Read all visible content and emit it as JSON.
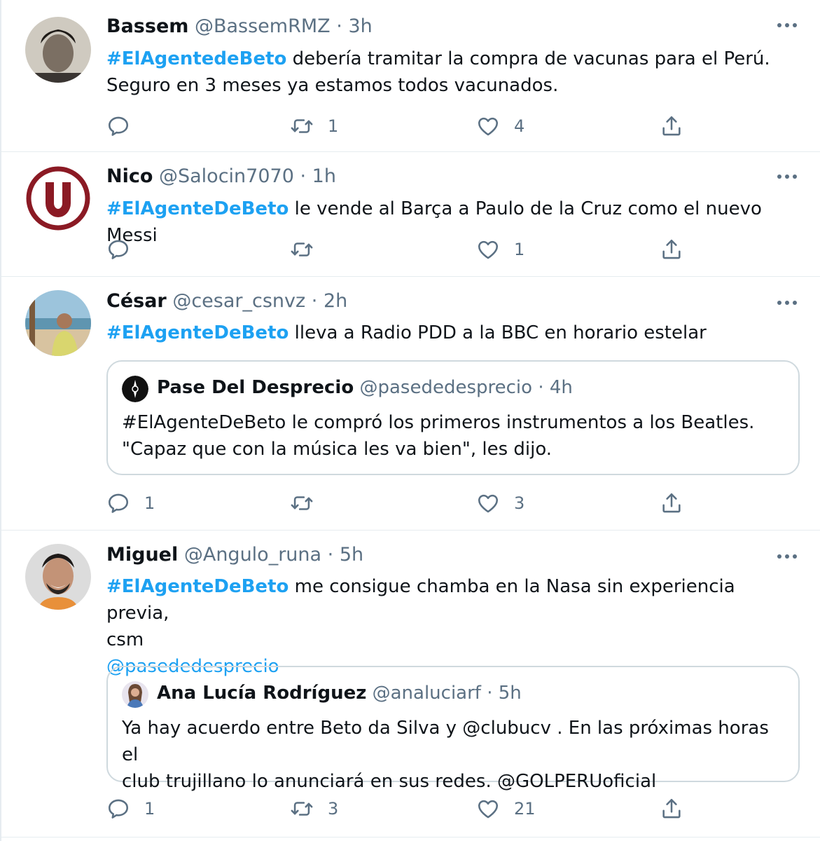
{
  "tweets": [
    {
      "name": "Bassem",
      "handle": "@BassemRMZ",
      "time": "3h",
      "hashtag": "#ElAgentedeBeto",
      "text": " debería tramitar la compra de vacunas para el Perú. Seguro en 3 meses ya estamos todos vacunados.",
      "replies": "",
      "retweets": "1",
      "likes": "4"
    },
    {
      "name": "Nico",
      "handle": "@Salocin7070",
      "time": "1h",
      "hashtag": "#ElAgenteDeBeto",
      "text": " le vende al Barça a Paulo de la Cruz como el nuevo Messi",
      "replies": "",
      "retweets": "",
      "likes": "1"
    },
    {
      "name": "César",
      "handle": "@cesar_csnvz",
      "time": "2h",
      "hashtag": "#ElAgenteDeBeto",
      "text": " lleva a Radio PDD a la BBC en horario estelar",
      "quote": {
        "name": "Pase Del Desprecio",
        "handle": "@pasededesprecio",
        "time": "4h",
        "line1": "#ElAgenteDeBeto le compró los primeros instrumentos a los Beatles.",
        "line2": "\"Capaz que con la música les va bien\", les dijo."
      },
      "replies": "1",
      "retweets": "",
      "likes": "3"
    },
    {
      "name": "Miguel",
      "handle": "@Angulo_runa",
      "time": "5h",
      "hashtag": "#ElAgenteDeBeto",
      "text": " me consigue chamba en la Nasa sin experiencia previa,",
      "text2": "csm",
      "mention": "@pasededesprecio",
      "quote": {
        "name": "Ana Lucía Rodríguez",
        "handle": "@analuciarf",
        "time": "5h",
        "line1": "Ya hay acuerdo entre Beto da Silva y @clubucv . En las próximas horas el",
        "line2": "club trujillano lo anunciará en sus redes. @GOLPERUoficial"
      },
      "replies": "1",
      "retweets": "3",
      "likes": "21"
    }
  ],
  "separator": "·",
  "icons": {
    "reply": "reply-icon",
    "retweet": "retweet-icon",
    "like": "heart-icon",
    "share": "share-icon",
    "more": "more-options-icon"
  },
  "colors": {
    "accent": "#1da1f2",
    "secondary_text": "#5b7083",
    "border": "#e6ecf0"
  }
}
